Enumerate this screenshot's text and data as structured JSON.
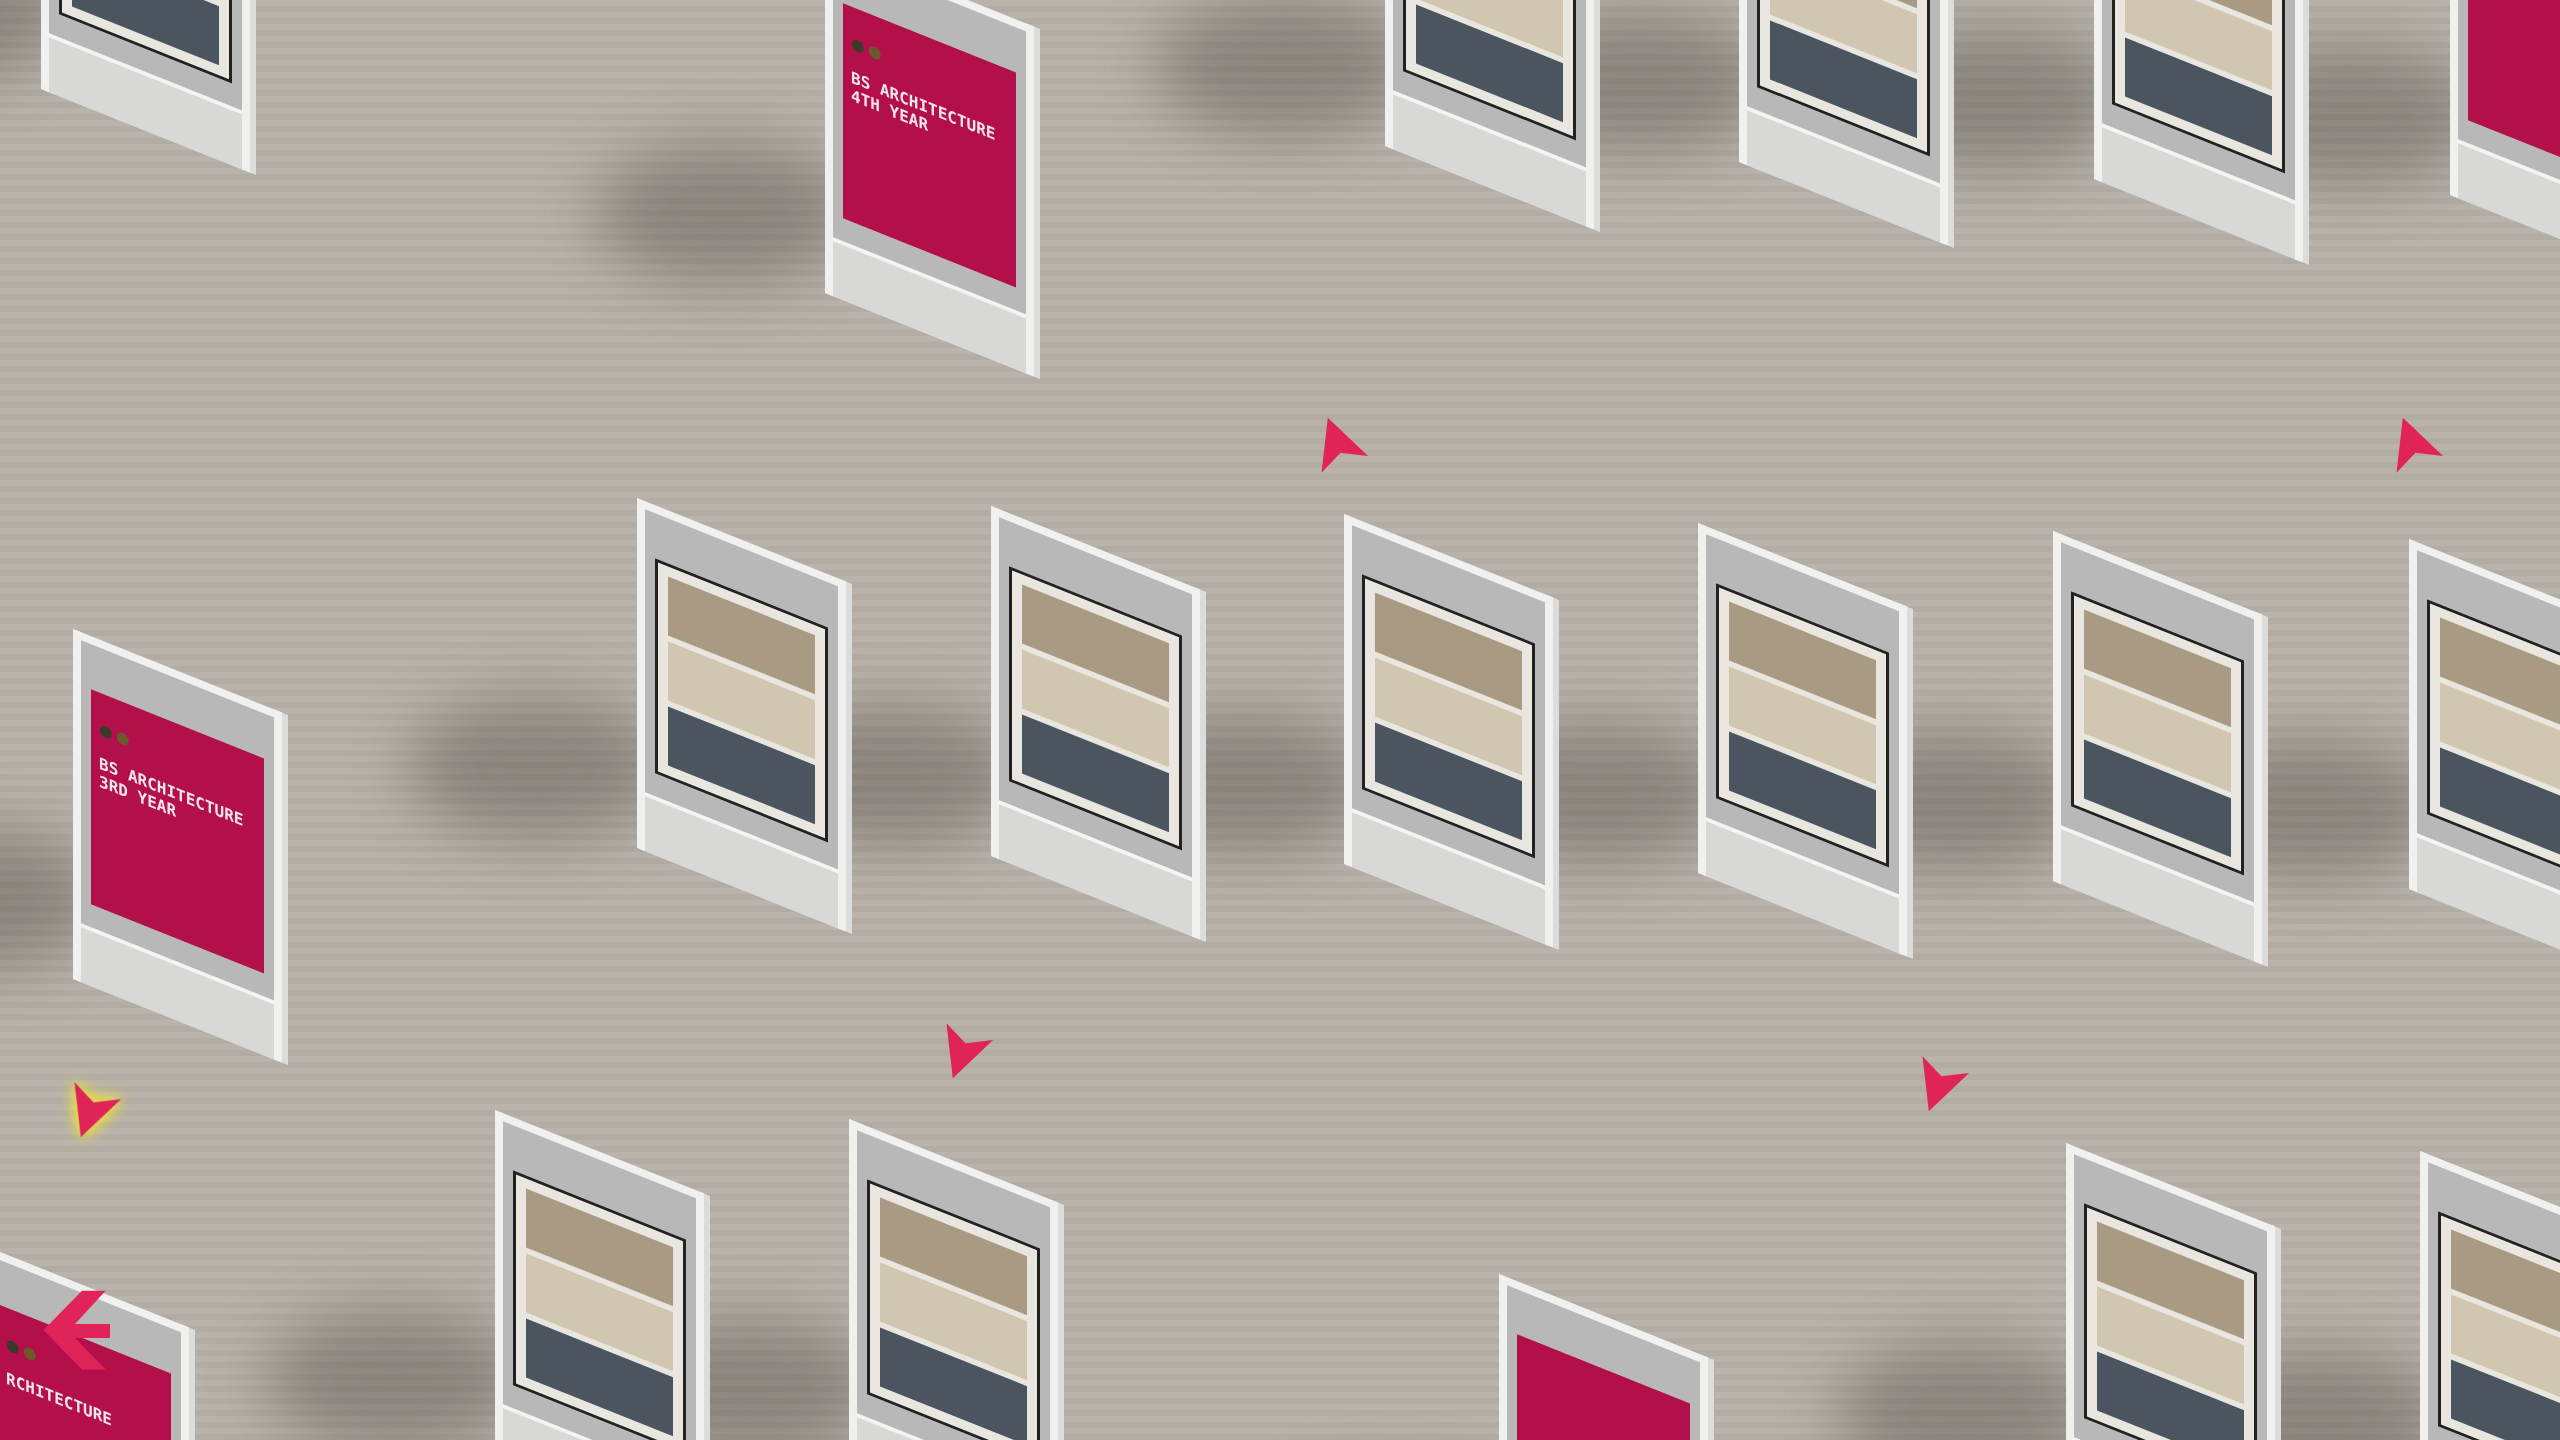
{
  "displays": [
    {
      "kind": "image"
    },
    {
      "kind": "title",
      "title": "BS ARCHITECTURE 4TH YEAR"
    },
    {
      "kind": "image"
    },
    {
      "kind": "image"
    },
    {
      "kind": "image"
    },
    {
      "kind": "title"
    },
    {
      "kind": "title",
      "title": "BS ARCHITECTURE 3RD YEAR"
    },
    {
      "kind": "image"
    },
    {
      "kind": "image"
    },
    {
      "kind": "image"
    },
    {
      "kind": "image"
    },
    {
      "kind": "image"
    },
    {
      "kind": "image"
    },
    {
      "kind": "title",
      "title": "RCHITECTURE"
    },
    {
      "kind": "image"
    },
    {
      "kind": "image"
    },
    {
      "kind": "title"
    },
    {
      "kind": "image"
    },
    {
      "kind": "image"
    }
  ],
  "markers": [
    {
      "selected": false
    },
    {
      "selected": false
    },
    {
      "selected": true
    },
    {
      "selected": false
    },
    {
      "selected": false
    }
  ]
}
